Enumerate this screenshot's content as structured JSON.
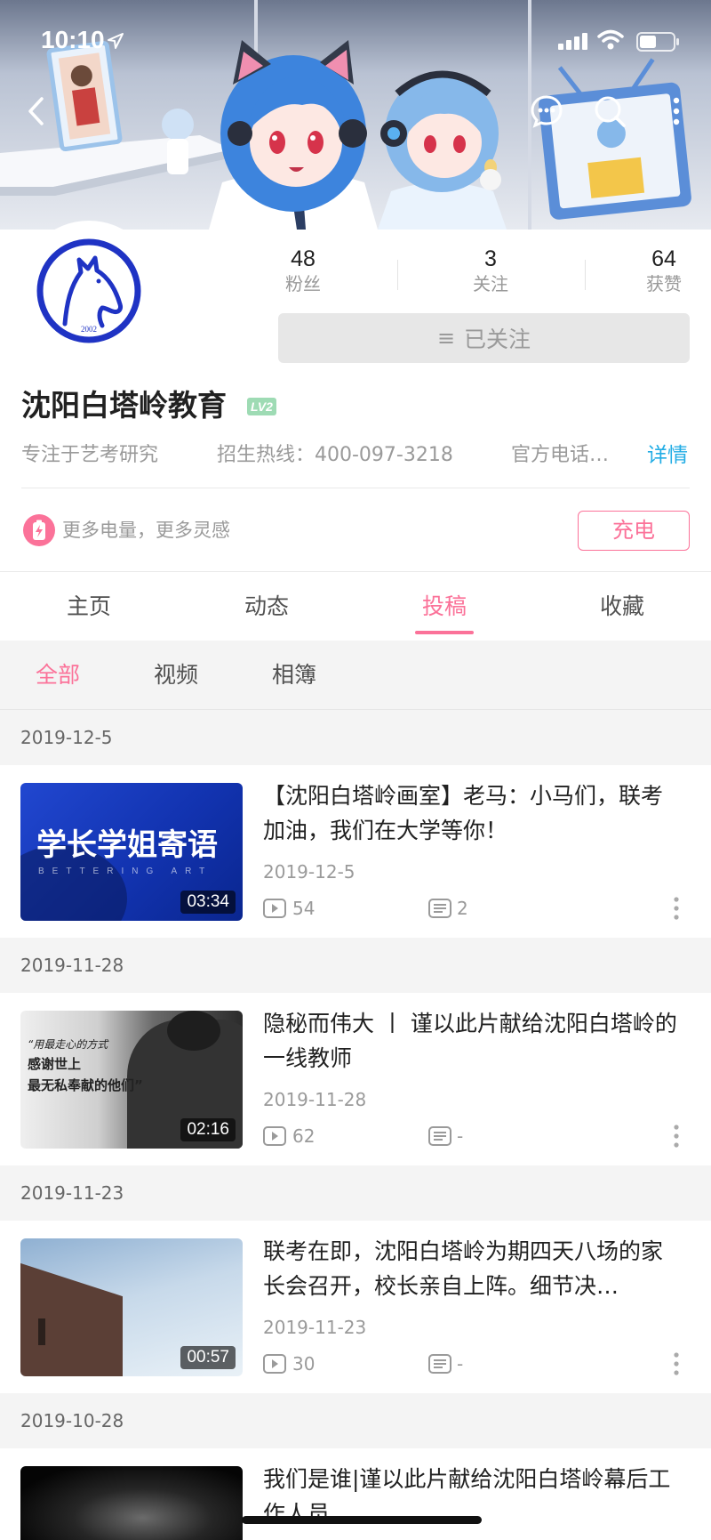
{
  "status_bar": {
    "time": "10:10"
  },
  "colors": {
    "accent": "#fb7299",
    "link": "#23ade5",
    "level": "#9edbb4"
  },
  "profile": {
    "avatar_text": "2002",
    "stats": [
      {
        "value": "48",
        "label": "粉丝"
      },
      {
        "value": "3",
        "label": "关注"
      },
      {
        "value": "64",
        "label": "获赞"
      }
    ],
    "follow_icon": "≡",
    "follow_label": "已关注",
    "name": "沈阳白塔岭教育",
    "level": "LV2",
    "bio": [
      "专注于艺考研究",
      "招生热线：400-097-3218",
      "官方电话…"
    ],
    "details_label": "详情"
  },
  "charge": {
    "text": "更多电量，更多灵感",
    "button": "充电"
  },
  "tabs": [
    {
      "label": "主页",
      "active": false
    },
    {
      "label": "动态",
      "active": false
    },
    {
      "label": "投稿",
      "active": true
    },
    {
      "label": "收藏",
      "active": false
    }
  ],
  "sub_tabs": [
    {
      "label": "全部",
      "active": true
    },
    {
      "label": "视频",
      "active": false
    },
    {
      "label": "相簿",
      "active": false
    }
  ],
  "videos": [
    {
      "group_date": "2019-12-5",
      "title": "【沈阳白塔岭画室】老马：小马们，联考加油，我们在大学等你！",
      "date": "2019-12-5",
      "duration": "03:34",
      "views": "54",
      "comments": "2",
      "thumb_text": [
        "学长学姐寄语",
        "BETTERING ART"
      ]
    },
    {
      "group_date": "2019-11-28",
      "title": "隐秘而伟大 丨 谨以此片献给沈阳白塔岭的一线教师",
      "date": "2019-11-28",
      "duration": "02:16",
      "views": "62",
      "comments": "-",
      "thumb_text": [
        "“用最走心的方式",
        "感谢世上",
        "最无私奉献的他们”"
      ]
    },
    {
      "group_date": "2019-11-23",
      "title": "联考在即，沈阳白塔岭为期四天八场的家长会召开，校长亲自上阵。细节决…",
      "date": "2019-11-23",
      "duration": "00:57",
      "views": "30",
      "comments": "-"
    },
    {
      "group_date": "2019-10-28",
      "title": "我们是谁|谨以此片献给沈阳白塔岭幕后工作人员"
    }
  ]
}
